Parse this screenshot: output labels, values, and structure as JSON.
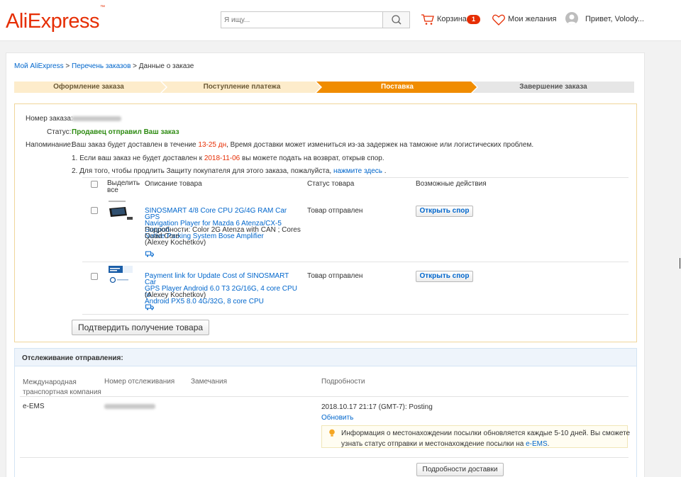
{
  "header": {
    "logo": "AliExpress",
    "logo_mark": "™",
    "search_placeholder": "Я ищу...",
    "cart_label": "Корзина",
    "cart_count": "1",
    "wishlist_label": "Мои желания",
    "greeting": "Привет, Volody..."
  },
  "breadcrumb": {
    "home": "Мой AliExpress",
    "sep1": " > ",
    "orders": "Перечень заказов",
    "sep2": " > ",
    "current": "Данные о заказе"
  },
  "steps": [
    "Оформление заказа",
    "Поступление платежа",
    "Поставка",
    "Завершение заказа"
  ],
  "active_step_color": "#f08c00",
  "order": {
    "number_label": "Номер заказа:",
    "status_label": "Статус:",
    "status_value": "Продавец отправил Ваш заказ",
    "reminder_label": "Напоминание:",
    "reminder_prefix": "Ваш заказ будет доставлен в течение ",
    "reminder_days": "13-25 дн",
    "reminder_suffix": ", Время доставки может измениться из-за задержек на таможне или логистических проблем.",
    "note1_prefix": "1. Если ваш заказ не будет доставлен к ",
    "note1_date": "2018-11-06",
    "note1_suffix": " вы можете подать на возврат, открыв спор.",
    "note2_prefix": "2. Для того, чтобы продлить Защиту покупателя для этого заказа, пожалуйста, ",
    "note2_link": "нажмите здесь",
    "note2_suffix": " ."
  },
  "table": {
    "select_all_line1": "Выделить",
    "select_all_line2": "все",
    "col_description": "Описание товара",
    "col_status": "Статус товара",
    "col_actions": "Возможные действия"
  },
  "items": [
    {
      "name_lines": [
        "SINOSMART 4/8 Core CPU 2G/4G RAM Car GPS",
        "Navigation Player for Mazda 6 Atenza/CX-5 Support",
        "Native Parking System Bose Amplifier"
      ],
      "detail_lines": [
        "Подробности: Color 2G Atenza with CAN   ; Cores",
        "Quad Core",
        "(Alexey Kochetkov)"
      ],
      "status": "Товар отправлен",
      "action": "Открыть спор"
    },
    {
      "name_lines": [
        "Payment link for Update Cost of SINOSMART Car",
        "GPS Player Android 6.0 T3 2G/16G, 4 core CPU to",
        "Android PX5 8.0 4G/32G, 8 core CPU"
      ],
      "detail_lines": [
        "(Alexey Kochetkov)"
      ],
      "status": "Товар отправлен",
      "action": "Открыть спор"
    }
  ],
  "confirm_button": "Подтвердить получение товара",
  "tracking": {
    "title": "Отслеживание отправления:",
    "col_company_line1": "Международная",
    "col_company_line2": "транспортная компания",
    "col_number": "Номер отслеживания",
    "col_remarks": "Замечания",
    "col_details": "Подробности",
    "company": "e-EMS",
    "event": "2018.10.17 21:17 (GMT-7): Posting",
    "refresh": "Обновить",
    "info_line1": "Информация о местонахождении посылки обновляется каждые 5-10 дней. Вы сможете",
    "info_line2_prefix": "узнать статус отправки и местонахождение посылки на ",
    "info_link": "e-EMS",
    "info_line2_suffix": ".",
    "details_button": "Подробности доставки"
  }
}
